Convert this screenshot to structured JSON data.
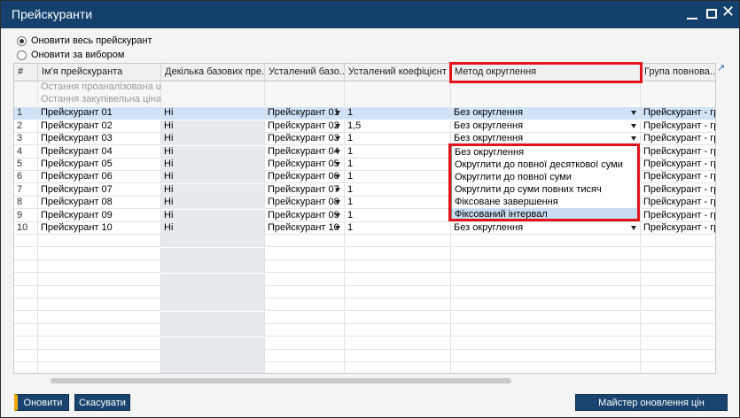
{
  "window": {
    "title": "Прейскуранти"
  },
  "options": {
    "update_all": "Оновити весь прейскурант",
    "update_selected": "Оновити за вибором"
  },
  "table": {
    "columns": [
      "#",
      "Ім'я прейскуранта",
      "Декілька базових пре...",
      "Усталений базо...",
      "Усталений коефіцієнт",
      "Метод округлення",
      "Група повнова..."
    ],
    "sub_rows": [
      "Остання проаналізована ціна",
      "Остання закупівельна ціна"
    ],
    "rows": [
      {
        "num": "1",
        "name": "Прейскурант 01",
        "multi": "Ні",
        "base": "Прейскурант 01",
        "coef": "1",
        "method": "Без округлення",
        "group": "Прейскурант - гр"
      },
      {
        "num": "2",
        "name": "Прейскурант 02",
        "multi": "Ні",
        "base": "Прейскурант 02",
        "coef": "1,5",
        "method": "Без округлення",
        "group": "Прейскурант - гр"
      },
      {
        "num": "3",
        "name": "Прейскурант 03",
        "multi": "Ні",
        "base": "Прейскурант 03",
        "coef": "1",
        "method": "Без округлення",
        "group": "Прейскурант - гр"
      },
      {
        "num": "4",
        "name": "Прейскурант 04",
        "multi": "Ні",
        "base": "Прейскурант 04",
        "coef": "1",
        "method": "",
        "group": "Прейскурант - гр"
      },
      {
        "num": "5",
        "name": "Прейскурант 05",
        "multi": "Ні",
        "base": "Прейскурант 05",
        "coef": "1",
        "method": "",
        "group": "Прейскурант - гр"
      },
      {
        "num": "6",
        "name": "Прейскурант 06",
        "multi": "Ні",
        "base": "Прейскурант 06",
        "coef": "1",
        "method": "",
        "group": "Прейскурант - гр"
      },
      {
        "num": "7",
        "name": "Прейскурант 07",
        "multi": "Ні",
        "base": "Прейскурант 07",
        "coef": "1",
        "method": "",
        "group": "Прейскурант - гр"
      },
      {
        "num": "8",
        "name": "Прейскурант 08",
        "multi": "Ні",
        "base": "Прейскурант 08",
        "coef": "1",
        "method": "",
        "group": "Прейскурант - гр"
      },
      {
        "num": "9",
        "name": "Прейскурант 09",
        "multi": "Ні",
        "base": "Прейскурант 09",
        "coef": "1",
        "method": "",
        "group": "Прейскурант - гр"
      },
      {
        "num": "10",
        "name": "Прейскурант 10",
        "multi": "Ні",
        "base": "Прейскурант 10",
        "coef": "1",
        "method": "Без округлення",
        "group": "Прейскурант - гр"
      }
    ]
  },
  "dropdown": {
    "options": [
      "Без округлення",
      "Округлити до повної десяткової суми",
      "Округлити до повної суми",
      "Округлити до суми повних тисяч",
      "Фіксоване завершення",
      "Фіксований інтервал"
    ],
    "highlighted_index": 5
  },
  "buttons": {
    "update": "Оновити",
    "cancel": "Скасувати",
    "wizard": "Майстер оновлення цін"
  },
  "colors": {
    "titlebar": "#14406e",
    "highlight": "#e3131b",
    "selected_row": "#cfe2f7",
    "button": "#1a446f",
    "button_accent": "#f0ab00"
  }
}
